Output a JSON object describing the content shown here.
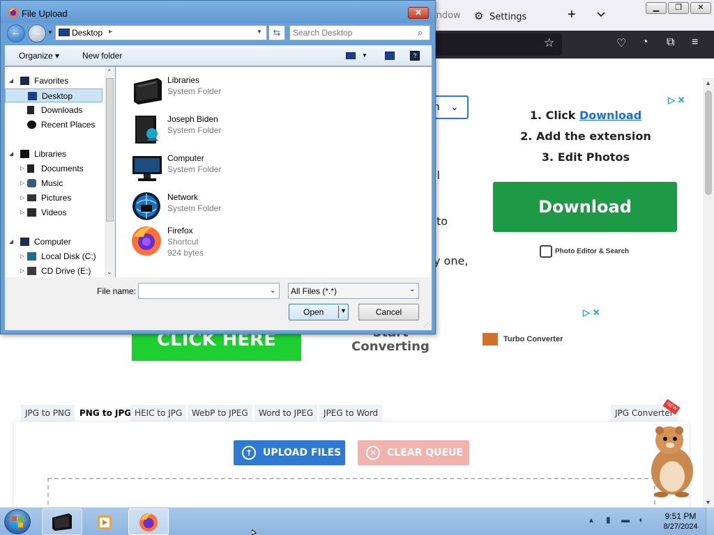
{
  "browser": {
    "tabs": {
      "partial_tab": "indow",
      "settings_tab": "Settings"
    },
    "new_tab": "+",
    "tab_list": "⌄",
    "window_controls": {
      "minimize": "▁",
      "maximize": "❐",
      "close": "✕"
    },
    "toolbar_icons": {
      "star": "☆",
      "pocket": "♡",
      "account": "◔",
      "extensions": "⧉",
      "menu": "≡"
    }
  },
  "page": {
    "select_partial": "n",
    "fragments": [
      "il",
      "to",
      "y one,"
    ],
    "ad1": {
      "step1_prefix": "1. Click ",
      "step1_link": "Download",
      "step2": "2. Add the extension",
      "step3": "3. Edit Photos",
      "download_button": "Download",
      "brand": "Photo Editor & Search"
    },
    "ad2": {
      "click_here": "CLICK HERE",
      "start": "Start",
      "converting": "Converting",
      "brand": "Turbo Converter"
    },
    "converter_tabs": [
      "JPG to PNG",
      "PNG to JPG",
      "HEIC to JPG",
      "WebP to JPEG",
      "Word to JPEG",
      "JPEG to Word"
    ],
    "active_tab_index": 1,
    "right_tab": "JPG Converter",
    "new_badge": "NEW",
    "upload_button": "UPLOAD FILES",
    "clear_button": "CLEAR QUEUE"
  },
  "dialog": {
    "title": "File Upload",
    "close": "✕",
    "address": {
      "location": "Desktop",
      "separator": "▸"
    },
    "search_placeholder": "Search Desktop",
    "toolbar": {
      "organize": "Organize ▾",
      "new_folder": "New folder"
    },
    "nav": {
      "favorites": "Favorites",
      "desktop": "Desktop",
      "downloads": "Downloads",
      "recent_places": "Recent Places",
      "libraries": "Libraries",
      "documents": "Documents",
      "music": "Music",
      "pictures": "Pictures",
      "videos": "Videos",
      "computer": "Computer",
      "local_disk": "Local Disk (C:)",
      "cd_drive": "CD Drive (E:)"
    },
    "files": [
      {
        "name": "Libraries",
        "type": "System Folder"
      },
      {
        "name": "Joseph Biden",
        "type": "System Folder"
      },
      {
        "name": "Computer",
        "type": "System Folder"
      },
      {
        "name": "Network",
        "type": "System Folder"
      },
      {
        "name": "Firefox",
        "type": "Shortcut",
        "size": "924 bytes"
      }
    ],
    "file_name_label": "File name:",
    "file_name_value": "",
    "file_type": "All Files (*.*)",
    "open": "Open",
    "cancel": "Cancel"
  },
  "taskbar": {
    "time": "9:51 PM",
    "date": "8/27/2024",
    "tray_icons": [
      "▴",
      "▮",
      "▬",
      "◖"
    ]
  },
  "colors": {
    "dialog_frame": "#6aa0d8",
    "download_green": "#1e9a46",
    "click_here_green": "#1fcf32",
    "upload_blue": "#2e7ad0",
    "clear_pink": "#f2b3ae",
    "firefox_dark": "#2b2a33"
  }
}
